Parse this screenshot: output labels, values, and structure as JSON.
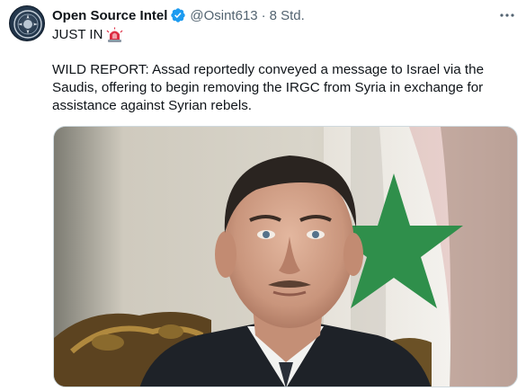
{
  "author": {
    "name": "Open Source Intel",
    "handle": "@Osint613",
    "separator": "·",
    "time": "8 Std."
  },
  "icons": {
    "avatar": "osint-emblem-icon",
    "verified": "verified-badge-icon",
    "more": "more-options-icon",
    "siren": "rotating-light-emoji-icon"
  },
  "tweet": {
    "first_line": "JUST IN",
    "body": "WILD REPORT: Assad reportedly conveyed a message to Israel via the Saudis, offering to begin removing the IRGC from Syria in exchange for assistance against Syrian rebels."
  },
  "colors": {
    "verified": "#1d9bf0",
    "secondary_text": "#536471",
    "text": "#0f1419"
  }
}
